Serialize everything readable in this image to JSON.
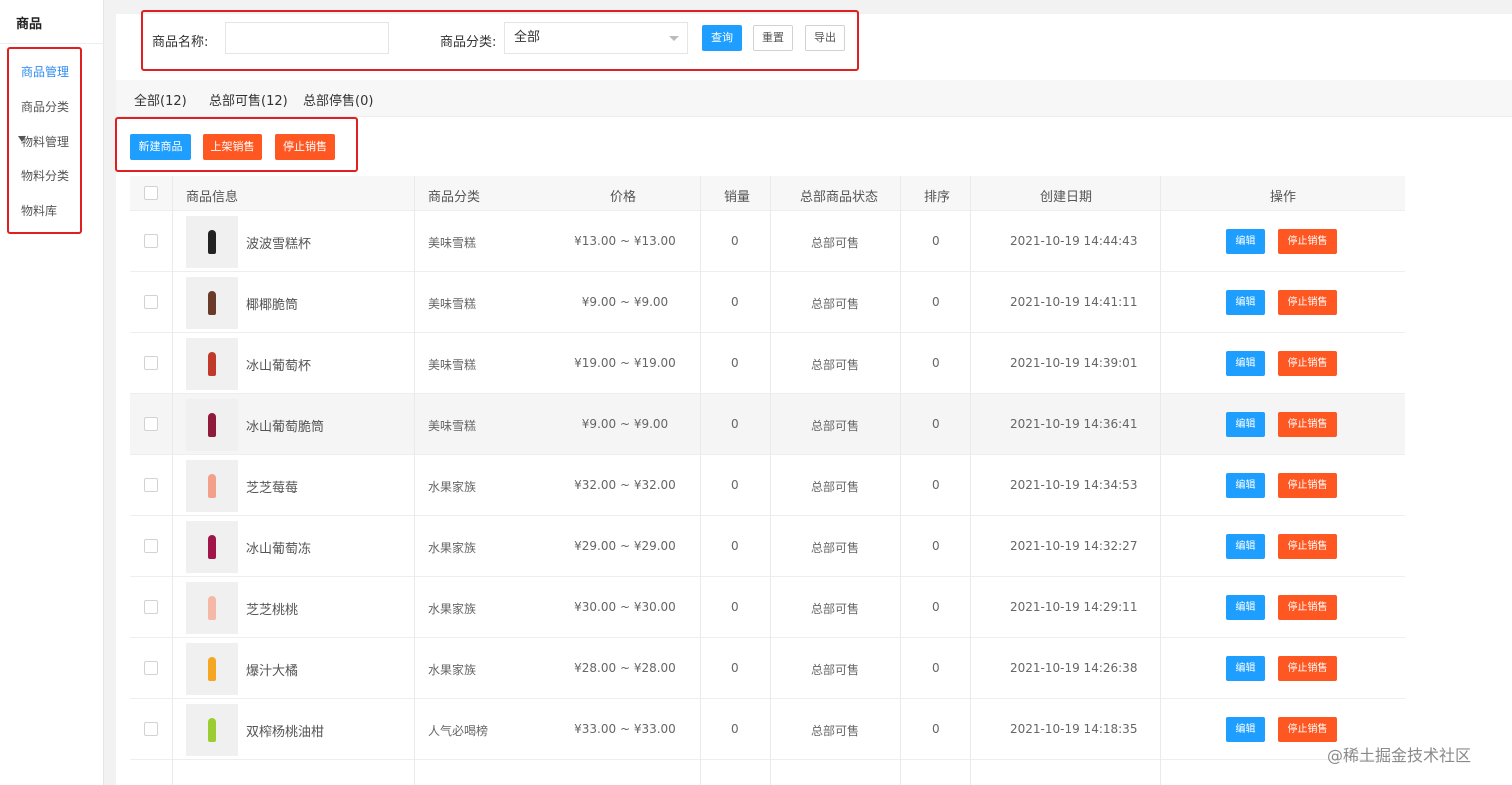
{
  "sidebar": {
    "title": "商品",
    "items": [
      {
        "label": "商品管理",
        "active": true
      },
      {
        "label": "商品分类",
        "active": false
      },
      {
        "label": "物料管理",
        "active": false,
        "expandable": true
      },
      {
        "label": "物料分类",
        "active": false
      },
      {
        "label": "物料库",
        "active": false
      }
    ]
  },
  "filter": {
    "name_label": "商品名称:",
    "name_value": "",
    "category_label": "商品分类:",
    "category_value": "全部",
    "query_label": "查询",
    "reset_label": "重置",
    "export_label": "导出"
  },
  "tabs": [
    {
      "label": "全部(12)",
      "active": true
    },
    {
      "label": "总部可售(12)",
      "active": false
    },
    {
      "label": "总部停售(0)",
      "active": false
    }
  ],
  "actions": {
    "new_label": "新建商品",
    "onsale_label": "上架销售",
    "stop_label": "停止销售"
  },
  "table": {
    "headers": {
      "info": "商品信息",
      "category": "商品分类",
      "price": "价格",
      "sales": "销量",
      "status": "总部商品状态",
      "sort": "排序",
      "created": "创建日期",
      "ops": "操作"
    },
    "edit_label": "编辑",
    "stop_label": "停止销售",
    "rows": [
      {
        "name": "波波雪糕杯",
        "category": "美味雪糕",
        "price": "¥13.00 ~ ¥13.00",
        "sales": "0",
        "status": "总部可售",
        "sort": "0",
        "created": "2021-10-19 14:44:43",
        "color": "#222222"
      },
      {
        "name": "椰椰脆筒",
        "category": "美味雪糕",
        "price": "¥9.00 ~ ¥9.00",
        "sales": "0",
        "status": "总部可售",
        "sort": "0",
        "created": "2021-10-19 14:41:11",
        "color": "#6b3b2a"
      },
      {
        "name": "冰山葡萄杯",
        "category": "美味雪糕",
        "price": "¥19.00 ~ ¥19.00",
        "sales": "0",
        "status": "总部可售",
        "sort": "0",
        "created": "2021-10-19 14:39:01",
        "color": "#c0392b"
      },
      {
        "name": "冰山葡萄脆筒",
        "category": "美味雪糕",
        "price": "¥9.00 ~ ¥9.00",
        "sales": "0",
        "status": "总部可售",
        "sort": "0",
        "created": "2021-10-19 14:36:41",
        "color": "#8e1b3a"
      },
      {
        "name": "芝芝莓莓",
        "category": "水果家族",
        "price": "¥32.00 ~ ¥32.00",
        "sales": "0",
        "status": "总部可售",
        "sort": "0",
        "created": "2021-10-19 14:34:53",
        "color": "#f2a08a"
      },
      {
        "name": "冰山葡萄冻",
        "category": "水果家族",
        "price": "¥29.00 ~ ¥29.00",
        "sales": "0",
        "status": "总部可售",
        "sort": "0",
        "created": "2021-10-19 14:32:27",
        "color": "#a0154a"
      },
      {
        "name": "芝芝桃桃",
        "category": "水果家族",
        "price": "¥30.00 ~ ¥30.00",
        "sales": "0",
        "status": "总部可售",
        "sort": "0",
        "created": "2021-10-19 14:29:11",
        "color": "#f5b7a6"
      },
      {
        "name": "爆汁大橘",
        "category": "水果家族",
        "price": "¥28.00 ~ ¥28.00",
        "sales": "0",
        "status": "总部可售",
        "sort": "0",
        "created": "2021-10-19 14:26:38",
        "color": "#f5a623"
      },
      {
        "name": "双榨杨桃油柑",
        "category": "人气必喝榜",
        "price": "¥33.00 ~ ¥33.00",
        "sales": "0",
        "status": "总部可售",
        "sort": "0",
        "created": "2021-10-19 14:18:35",
        "color": "#9acd32"
      }
    ]
  },
  "watermark": "@稀土掘金技术社区",
  "colors": {
    "primary": "#1e9fff",
    "danger": "#ff5722",
    "active_menu": "#2d8cf0",
    "highlight_box": "#e02020"
  }
}
